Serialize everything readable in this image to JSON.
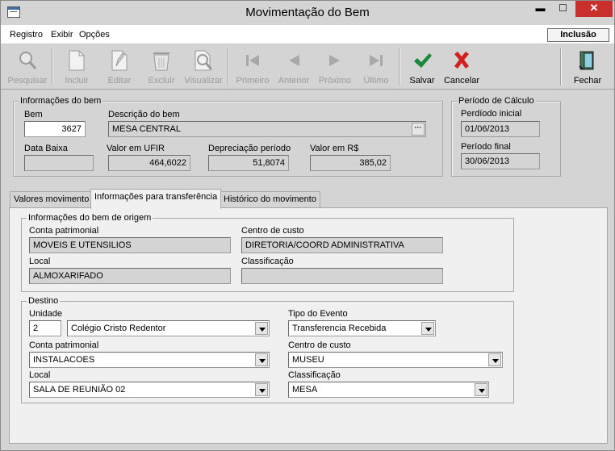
{
  "window": {
    "title": "Movimentação do Bem",
    "min": "▬",
    "max": "☐",
    "close": "✕"
  },
  "menu": {
    "items": [
      "Registro",
      "Exibir",
      "Opções"
    ],
    "mode": "Inclusão"
  },
  "toolbar": {
    "pesquisar": "Pesquisar",
    "incluir": "Incluir",
    "editar": "Editar",
    "excluir": "Excluir",
    "visualizar": "Visualizar",
    "primeiro": "Primeiro",
    "anterior": "Anterior",
    "proximo": "Próximo",
    "ultimo": "Último",
    "salvar": "Salvar",
    "cancelar": "Cancelar",
    "fechar": "Fechar"
  },
  "info": {
    "group": "Informações do bem",
    "bem_label": "Bem",
    "bem": "3627",
    "descricao_label": "Descrição do bem",
    "descricao": "MESA CENTRAL",
    "descricao_btn": "···",
    "data_baixa_label": "Data Baixa",
    "data_baixa": "",
    "ufir_label": "Valor em UFIR",
    "ufir": "464,6022",
    "depr_label": "Depreciação período",
    "depr": "51,8074",
    "valor_label": "Valor em R$",
    "valor": "385,02"
  },
  "periodo": {
    "group": "Período de Cálculo",
    "inicial_label": "Perdíodo inicial",
    "inicial": "01/06/2013",
    "final_label": "Período final",
    "final": "30/06/2013"
  },
  "tabs": [
    "Valores movimento",
    "Informações para transferência",
    "Histórico do movimento"
  ],
  "origem": {
    "group": "Informações do bem de origem",
    "conta_label": "Conta patrimonial",
    "conta": "MOVEIS E UTENSILIOS",
    "centro_label": "Centro de custo",
    "centro": "DIRETORIA/COORD ADMINISTRATIVA",
    "local_label": "Local",
    "local": "ALMOXARIFADO",
    "class_label": "Classificação",
    "class": ""
  },
  "destino": {
    "group": "Destino",
    "unidade_label": "Unidade",
    "unidade_code": "2",
    "unidade": "Colégio Cristo Redentor",
    "tipo_label": "Tipo do Evento",
    "tipo": "Transferencia Recebida",
    "conta_label": "Conta patrimonial",
    "conta": "INSTALACOES",
    "centro_label": "Centro de custo",
    "centro": "MUSEU",
    "local_label": "Local",
    "local": "SALA DE REUNIÃO 02",
    "class_label": "Classificação",
    "class": "MESA"
  },
  "colors": {
    "salvar": "#1a8a3a",
    "cancelar": "#d21f1f",
    "close": "#c9302c"
  }
}
